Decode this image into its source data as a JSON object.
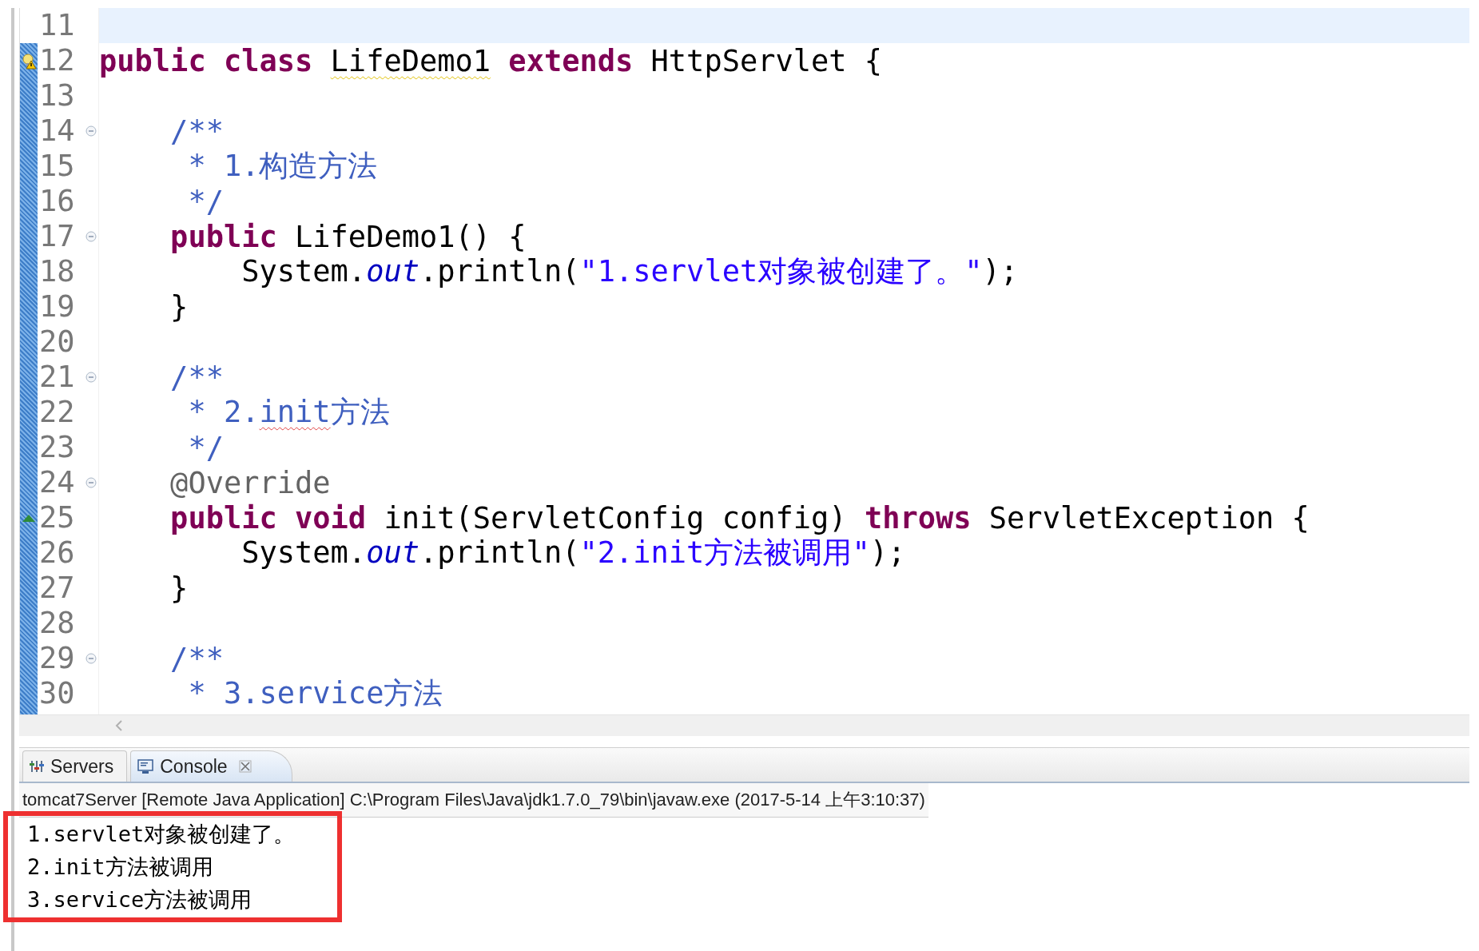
{
  "editor": {
    "lines": [
      {
        "number": "11",
        "current": true
      },
      {
        "number": "12",
        "has_warning": true,
        "tokens": [
          {
            "kind": "keyword",
            "text": "public class "
          },
          {
            "kind": "plain",
            "text": "LifeDemo1",
            "warning": true
          },
          {
            "kind": "keyword",
            "text": " extends "
          },
          {
            "kind": "plain",
            "text": "HttpServlet {"
          }
        ]
      },
      {
        "number": "13"
      },
      {
        "number": "14",
        "foldable": true,
        "tokens": [
          {
            "kind": "comment",
            "text": "    /**"
          }
        ]
      },
      {
        "number": "15",
        "tokens": [
          {
            "kind": "comment",
            "text": "     * 1.构造方法"
          }
        ]
      },
      {
        "number": "16",
        "tokens": [
          {
            "kind": "comment",
            "text": "     */"
          }
        ]
      },
      {
        "number": "17",
        "foldable": true,
        "tokens": [
          {
            "kind": "keyword",
            "text": "    public "
          },
          {
            "kind": "plain",
            "text": "LifeDemo1() {"
          }
        ]
      },
      {
        "number": "18",
        "tokens": [
          {
            "kind": "plain",
            "text": "        System."
          },
          {
            "kind": "field",
            "text": "out"
          },
          {
            "kind": "plain",
            "text": ".println("
          },
          {
            "kind": "string",
            "text": "\"1.servlet对象被创建了。\""
          },
          {
            "kind": "plain",
            "text": ");"
          }
        ]
      },
      {
        "number": "19",
        "tokens": [
          {
            "kind": "plain",
            "text": "    }"
          }
        ]
      },
      {
        "number": "20"
      },
      {
        "number": "21",
        "foldable": true,
        "tokens": [
          {
            "kind": "comment",
            "text": "    /**"
          }
        ]
      },
      {
        "number": "22",
        "tokens": [
          {
            "kind": "comment",
            "text": "     * 2."
          },
          {
            "kind": "comment",
            "text": "init",
            "misspelled": true
          },
          {
            "kind": "comment",
            "text": "方法"
          }
        ]
      },
      {
        "number": "23",
        "tokens": [
          {
            "kind": "comment",
            "text": "     */"
          }
        ]
      },
      {
        "number": "24",
        "foldable": true,
        "tokens": [
          {
            "kind": "annotation",
            "text": "    @Override"
          }
        ]
      },
      {
        "number": "25",
        "overrides": true,
        "tokens": [
          {
            "kind": "keyword",
            "text": "    public void "
          },
          {
            "kind": "plain",
            "text": "init(ServletConfig config) "
          },
          {
            "kind": "keyword",
            "text": "throws "
          },
          {
            "kind": "plain",
            "text": "ServletException {"
          }
        ]
      },
      {
        "number": "26",
        "tokens": [
          {
            "kind": "plain",
            "text": "        System."
          },
          {
            "kind": "field",
            "text": "out"
          },
          {
            "kind": "plain",
            "text": ".println("
          },
          {
            "kind": "string",
            "text": "\"2.init方法被调用\""
          },
          {
            "kind": "plain",
            "text": ");"
          }
        ]
      },
      {
        "number": "27",
        "tokens": [
          {
            "kind": "plain",
            "text": "    }"
          }
        ]
      },
      {
        "number": "28"
      },
      {
        "number": "29",
        "foldable": true,
        "tokens": [
          {
            "kind": "comment",
            "text": "    /**"
          }
        ]
      },
      {
        "number": "30",
        "tokens": [
          {
            "kind": "comment",
            "text": "     * 3.service方法"
          }
        ]
      }
    ]
  },
  "panel": {
    "tabs": [
      {
        "label": "Servers",
        "kind": "servers",
        "selected": false
      },
      {
        "label": "Console",
        "kind": "console",
        "selected": true,
        "closable": true
      }
    ],
    "console_title": "tomcat7Server [Remote Java Application] C:\\Program Files\\Java\\jdk1.7.0_79\\bin\\javaw.exe (2017-5-14 上午3:10:37)",
    "output": [
      "1.servlet对象被创建了。",
      "2.init方法被调用",
      "3.service方法被调用"
    ]
  }
}
